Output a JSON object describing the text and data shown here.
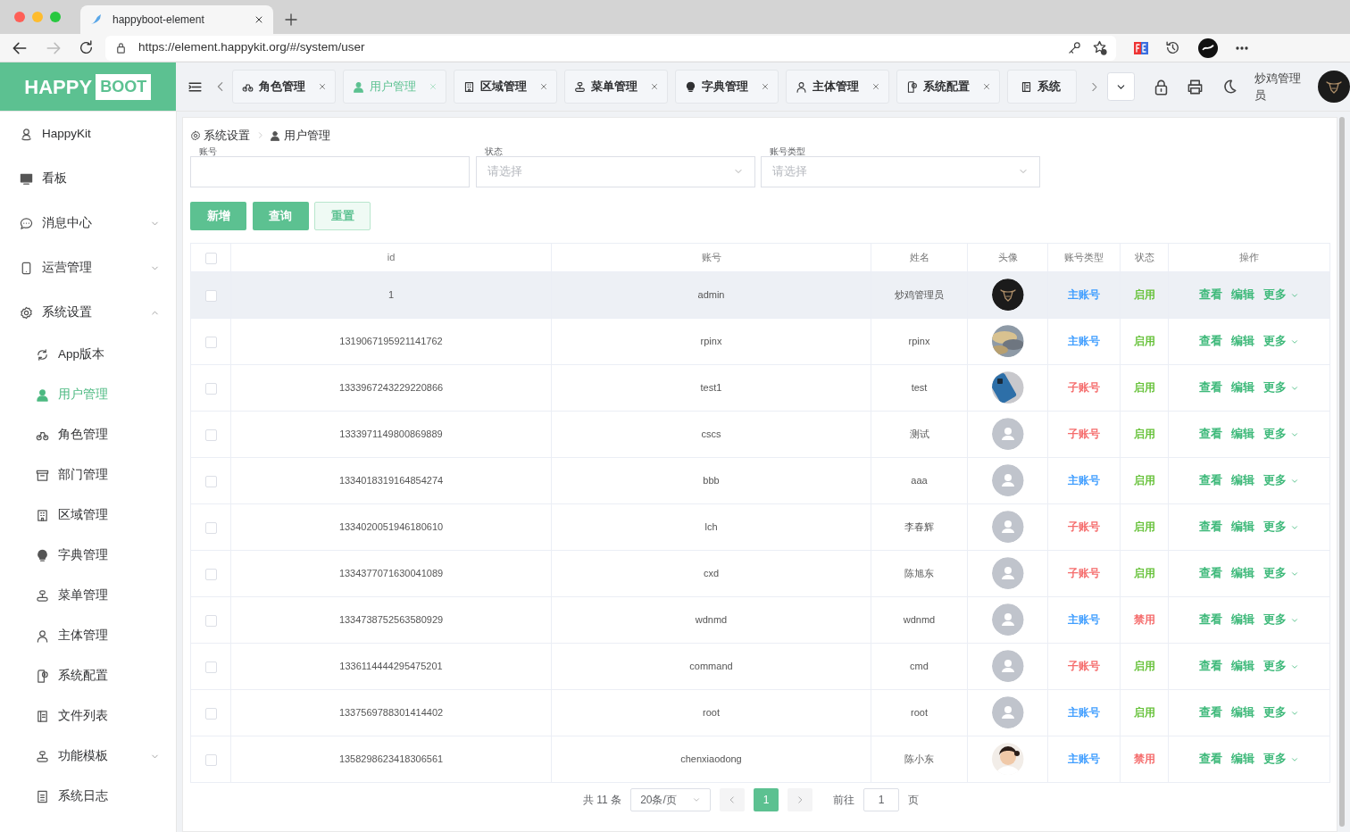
{
  "browser": {
    "tab_title": "happyboot-element",
    "url": "https://element.happykit.org/#/system/user"
  },
  "logo": {
    "part_1": "HAPPY",
    "part_2": "BOOT"
  },
  "tabs": [
    {
      "label": "角色管理",
      "selected": false,
      "closable": true
    },
    {
      "label": "用户管理",
      "selected": true,
      "closable": true
    },
    {
      "label": "区域管理",
      "selected": false,
      "closable": true
    },
    {
      "label": "菜单管理",
      "selected": false,
      "closable": true
    },
    {
      "label": "字典管理",
      "selected": false,
      "closable": true
    },
    {
      "label": "主体管理",
      "selected": false,
      "closable": true
    },
    {
      "label": "系统配置",
      "selected": false,
      "closable": true
    },
    {
      "label": "系统",
      "selected": false,
      "closable": false
    }
  ],
  "header": {
    "user_name": "炒鸡管理员"
  },
  "sidebar": {
    "items": [
      {
        "label": "HappyKit",
        "selected": false
      },
      {
        "label": "看板",
        "selected": false
      },
      {
        "label": "消息中心",
        "selected": false,
        "expanded": false
      },
      {
        "label": "运营管理",
        "selected": false,
        "expanded": false
      },
      {
        "label": "系统设置",
        "selected": false,
        "expanded": true,
        "children": [
          {
            "label": "App版本",
            "selected": false
          },
          {
            "label": "用户管理",
            "selected": true
          },
          {
            "label": "角色管理",
            "selected": false
          },
          {
            "label": "部门管理",
            "selected": false
          },
          {
            "label": "区域管理",
            "selected": false
          },
          {
            "label": "字典管理",
            "selected": false
          },
          {
            "label": "菜单管理",
            "selected": false
          },
          {
            "label": "主体管理",
            "selected": false
          },
          {
            "label": "系统配置",
            "selected": false
          },
          {
            "label": "文件列表",
            "selected": false
          },
          {
            "label": "功能模板",
            "selected": false,
            "expanded": false
          },
          {
            "label": "系统日志",
            "selected": false
          }
        ]
      }
    ]
  },
  "breadcrumb": [
    "系统设置",
    "用户管理"
  ],
  "filters": [
    {
      "kind": "input",
      "label": "账号"
    },
    {
      "kind": "select",
      "label": "状态",
      "placeholder": "请选择"
    },
    {
      "kind": "select",
      "label": "账号类型",
      "placeholder": "请选择"
    }
  ],
  "buttons": [
    {
      "label": "新增",
      "kind": "primary"
    },
    {
      "label": "查询",
      "kind": "primary"
    },
    {
      "label": "重置",
      "kind": "plain"
    }
  ],
  "table": {
    "header_checked": false,
    "columns": [
      "id",
      "账号",
      "姓名",
      "头像",
      "账号类型",
      "状态",
      "操作"
    ],
    "rows": [
      {
        "checked": false,
        "highlighted": true,
        "id": "1",
        "account": "admin",
        "name": "炒鸡管理员",
        "avatar": {
          "kind": "logo"
        },
        "type": {
          "text": "主账号",
          "color": "#409eff"
        },
        "status": {
          "text": "启用",
          "color": "#67c23a"
        },
        "actions": [
          "查看",
          "编辑",
          "更多"
        ]
      },
      {
        "checked": false,
        "highlighted": false,
        "id": "1319067195921141762",
        "account": "rpinx",
        "name": "rpinx",
        "type": {
          "text": "主账号",
          "color": "#409eff"
        },
        "status": {
          "text": "启用",
          "color": "#67c23a"
        },
        "actions": [
          "查看",
          "编辑",
          "更多"
        ]
      },
      {
        "checked": false,
        "highlighted": false,
        "id": "1333967243229220866",
        "account": "test1",
        "name": "test",
        "type": {
          "text": "子账号",
          "color": "#f56c6c"
        },
        "status": {
          "text": "启用",
          "color": "#67c23a"
        },
        "actions": [
          "查看",
          "编辑",
          "更多"
        ]
      },
      {
        "checked": false,
        "highlighted": false,
        "id": "1333971149800869889",
        "account": "cscs",
        "name": "测试",
        "avatar": {
          "kind": "default"
        },
        "type": {
          "text": "子账号",
          "color": "#f56c6c"
        },
        "status": {
          "text": "启用",
          "color": "#67c23a"
        },
        "actions": [
          "查看",
          "编辑",
          "更多"
        ]
      },
      {
        "checked": false,
        "highlighted": false,
        "id": "1334018319164854274",
        "account": "bbb",
        "name": "aaa",
        "avatar": {
          "kind": "default"
        },
        "type": {
          "text": "主账号",
          "color": "#409eff"
        },
        "status": {
          "text": "启用",
          "color": "#67c23a"
        },
        "actions": [
          "查看",
          "编辑",
          "更多"
        ]
      },
      {
        "checked": false,
        "highlighted": false,
        "id": "1334020051946180610",
        "account": "lch",
        "name": "李春辉",
        "avatar": {
          "kind": "default"
        },
        "type": {
          "text": "子账号",
          "color": "#f56c6c"
        },
        "status": {
          "text": "启用",
          "color": "#67c23a"
        },
        "actions": [
          "查看",
          "编辑",
          "更多"
        ]
      },
      {
        "checked": false,
        "highlighted": false,
        "id": "1334377071630041089",
        "account": "cxd",
        "name": "陈旭东",
        "avatar": {
          "kind": "default"
        },
        "type": {
          "text": "子账号",
          "color": "#f56c6c"
        },
        "status": {
          "text": "启用",
          "color": "#67c23a"
        },
        "actions": [
          "查看",
          "编辑",
          "更多"
        ]
      },
      {
        "checked": false,
        "highlighted": false,
        "id": "1334738752563580929",
        "account": "wdnmd",
        "name": "wdnmd",
        "avatar": {
          "kind": "default"
        },
        "type": {
          "text": "主账号",
          "color": "#409eff"
        },
        "status": {
          "text": "禁用",
          "color": "#f56c6c"
        },
        "actions": [
          "查看",
          "编辑",
          "更多"
        ]
      },
      {
        "checked": false,
        "highlighted": false,
        "id": "1336114444295475201",
        "account": "command",
        "name": "cmd",
        "avatar": {
          "kind": "default"
        },
        "type": {
          "text": "子账号",
          "color": "#f56c6c"
        },
        "status": {
          "text": "启用",
          "color": "#67c23a"
        },
        "actions": [
          "查看",
          "编辑",
          "更多"
        ]
      },
      {
        "checked": false,
        "highlighted": false,
        "id": "1337569788301414402",
        "account": "root",
        "name": "root",
        "avatar": {
          "kind": "default"
        },
        "type": {
          "text": "主账号",
          "color": "#409eff"
        },
        "status": {
          "text": "启用",
          "color": "#67c23a"
        },
        "actions": [
          "查看",
          "编辑",
          "更多"
        ]
      },
      {
        "checked": false,
        "highlighted": false,
        "id": "1358298623418306561",
        "account": "chenxiaodong",
        "name": "陈小东",
        "type": {
          "text": "主账号",
          "color": "#409eff"
        },
        "status": {
          "text": "禁用",
          "color": "#f56c6c"
        },
        "actions": [
          "查看",
          "编辑",
          "更多"
        ]
      }
    ]
  },
  "pagination": {
    "total": "共 11 条",
    "page_size": "20条/页",
    "current": "1",
    "goto_label": "前往",
    "goto_value": "1",
    "page_unit": "页"
  }
}
